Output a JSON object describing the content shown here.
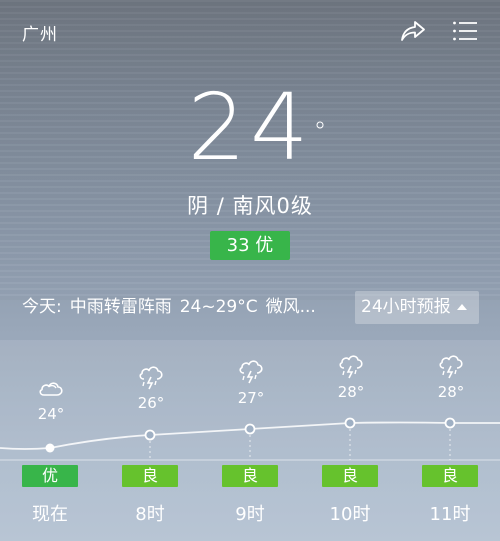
{
  "header": {
    "city": "广州",
    "share_icon": "share-icon",
    "menu_icon": "menu-icon"
  },
  "current": {
    "temperature": "24",
    "degree_symbol": "°",
    "condition": "阴 / 南风0级",
    "aqi": "33 优",
    "aqi_color": "#38b54a"
  },
  "today": {
    "label": "今天:",
    "weather": "中雨转雷阵雨",
    "range": "24~29°C",
    "wind": "微风..."
  },
  "forecast_toggle": {
    "label": "24小时预报"
  },
  "hourly": [
    {
      "time": "现在",
      "temp": "24°",
      "icon": "cloudy-icon",
      "aqi": "优",
      "aqi_color": "#38b54a"
    },
    {
      "time": "8时",
      "temp": "26°",
      "icon": "thunderstorm-icon",
      "aqi": "良",
      "aqi_color": "#66c22d"
    },
    {
      "time": "9时",
      "temp": "27°",
      "icon": "thunderstorm-icon",
      "aqi": "良",
      "aqi_color": "#66c22d"
    },
    {
      "time": "10时",
      "temp": "28°",
      "icon": "thunderstorm-icon",
      "aqi": "良",
      "aqi_color": "#66c22d"
    },
    {
      "time": "11时",
      "temp": "28°",
      "icon": "thunderstorm-icon",
      "aqi": "良",
      "aqi_color": "#66c22d"
    }
  ]
}
